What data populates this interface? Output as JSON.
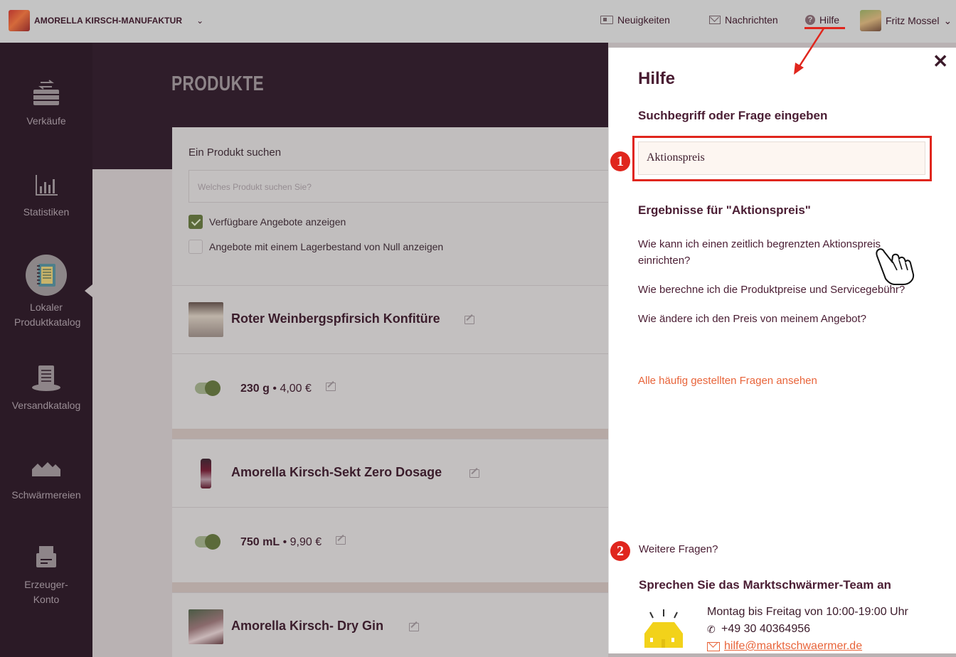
{
  "topbar": {
    "org_name": "AMORELLA KIRSCH-MANUFAKTUR",
    "org_caret": "⌄",
    "news_label": "Neuigkeiten",
    "messages_label": "Nachrichten",
    "help_label": "Hilfe",
    "help_icon": "?",
    "user_name": "Fritz Mossel",
    "user_caret": "⌄"
  },
  "sidebar": {
    "items": [
      {
        "label": "Verkäufe",
        "icon": "crate-icon"
      },
      {
        "label": "Statistiken",
        "icon": "bar-chart-icon"
      },
      {
        "label": "Lokaler Produktkatalog",
        "icon": "notebook-icon",
        "active": true
      },
      {
        "label": "Versandkatalog",
        "icon": "catalog-stack-icon"
      },
      {
        "label": "Schwärmereien",
        "icon": "houses-icon"
      },
      {
        "label": "Erzeuger-Konto",
        "icon": "printer-icon"
      }
    ]
  },
  "page": {
    "title": "PRODUKTE"
  },
  "search": {
    "label": "Ein Produkt suchen",
    "placeholder": "Welches Produkt suchen Sie?",
    "check_available": "Verfügbare Angebote anzeigen",
    "check_available_on": true,
    "check_zero_stock": "Angebote mit einem Lagerbestand von Null anzeigen",
    "check_zero_stock_on": false
  },
  "products": [
    {
      "name": "Roter Weinbergspfirsich Konfitüre",
      "variant_size": "230 g",
      "variant_sep": "•",
      "variant_price": "4,00 €"
    },
    {
      "name": "Amorella Kirsch-Sekt Zero Dosage",
      "variant_size": "750 mL",
      "variant_sep": "•",
      "variant_price": "9,90 €"
    },
    {
      "name": "Amorella Kirsch- Dry Gin"
    }
  ],
  "help_panel": {
    "close": "✕",
    "title": "Hilfe",
    "search_prompt": "Suchbegriff oder Frage eingeben",
    "search_value": "Aktionspreis",
    "badge_1": "1",
    "badge_2": "2",
    "results_title": "Ergebnisse für \"Aktionspreis\"",
    "results": [
      "Wie kann ich einen zeitlich begrenzten Aktionspreis einrichten?",
      "Wie berechne ich die Produktpreise und Servicegebühr?",
      "Wie ändere ich den Preis von meinem Angebot?"
    ],
    "faq_link": "Alle häufig gestellten Fragen ansehen",
    "more_questions": "Weitere Fragen?",
    "contact_title": "Sprechen Sie das Marktschwärmer-Team an",
    "hours": "Montag bis Freitag von 10:00-19:00 Uhr",
    "phone_icon": "✆",
    "phone": "+49 30 40364956",
    "email": "hilfe@marktschwaermer.de"
  },
  "colors": {
    "accent_red": "#e0261d",
    "brand_plum": "#4a1d33",
    "link_orange": "#e8643a",
    "toggle_green": "#5b6a3a"
  }
}
